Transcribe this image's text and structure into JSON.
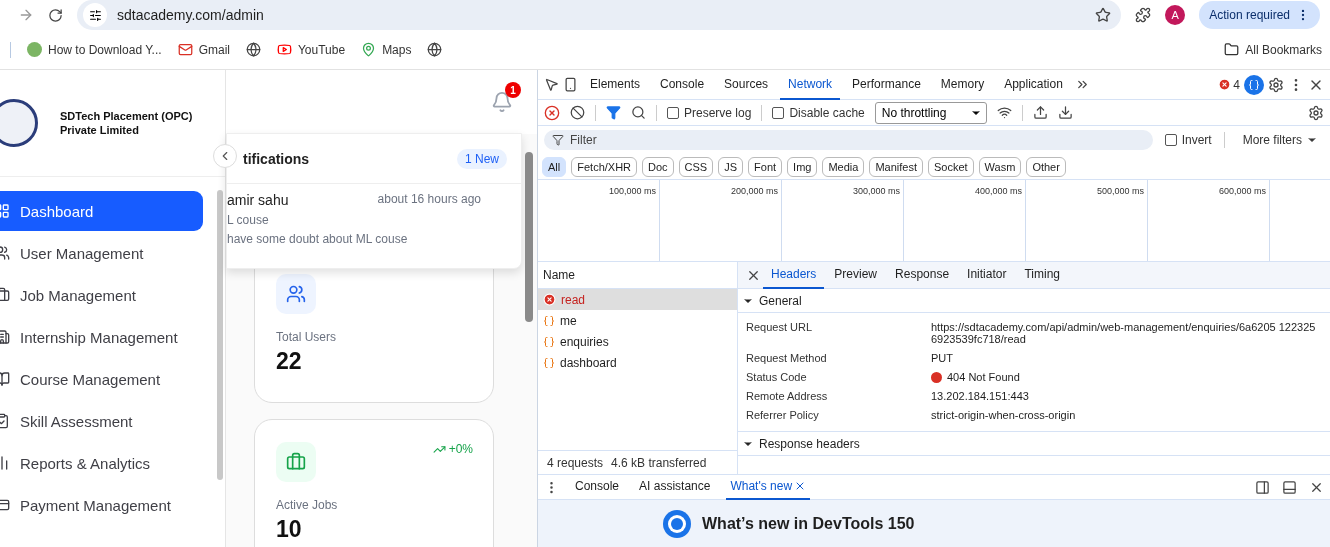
{
  "browser": {
    "address": "sdtacademy.com/admin",
    "profile_initial": "A",
    "action": "Action required",
    "bookmarks": [
      {
        "label": "How to Download Y...",
        "kind": "site"
      },
      {
        "label": "Gmail",
        "kind": "gmail"
      },
      {
        "kind": "globe"
      },
      {
        "label": "YouTube",
        "kind": "youtube"
      },
      {
        "label": "Maps",
        "kind": "maps"
      },
      {
        "kind": "globe"
      }
    ],
    "all_bookmarks": "All Bookmarks"
  },
  "page": {
    "company": "SDTech Placement (OPC) Private Limited",
    "notification_count": "1",
    "nav": [
      {
        "label": "Dashboard",
        "selected": true
      },
      {
        "label": "User Management",
        "selected": false
      },
      {
        "label": "Job Management",
        "selected": false
      },
      {
        "label": "Internship Management",
        "selected": false
      },
      {
        "label": "Course Management",
        "selected": false
      },
      {
        "label": "Skill Assessment",
        "selected": false
      },
      {
        "label": "Reports & Analytics",
        "selected": false
      },
      {
        "label": "Payment Management",
        "selected": false
      }
    ],
    "notifications": {
      "title": "tifications",
      "badge": "1 New",
      "items": [
        {
          "name": "amir sahu",
          "time": "about 16 hours ago",
          "subject": "L couse",
          "message": "have some doubt about ML couse"
        }
      ]
    },
    "stats": [
      {
        "kind": "users",
        "label": "Total Users",
        "value": "22"
      },
      {
        "kind": "jobs",
        "label": "Active Jobs",
        "value": "10",
        "change": "+0%"
      }
    ]
  },
  "devtools": {
    "panels": [
      {
        "label": "Elements",
        "selected": false
      },
      {
        "label": "Console",
        "selected": false
      },
      {
        "label": "Sources",
        "selected": false
      },
      {
        "label": "Network",
        "selected": true
      },
      {
        "label": "Performance",
        "selected": false
      },
      {
        "label": "Memory",
        "selected": false
      },
      {
        "label": "Application",
        "selected": false
      }
    ],
    "error_count": "4",
    "preserve_log": {
      "label": "Preserve log",
      "checked": false
    },
    "disable_cache": {
      "label": "Disable cache",
      "checked": false
    },
    "throttling": "No throttling",
    "filter_placeholder": "Filter",
    "invert": {
      "label": "Invert",
      "checked": false
    },
    "more_filters": "More filters",
    "type_filters": [
      {
        "label": "All",
        "selected": true
      },
      {
        "label": "Fetch/XHR",
        "selected": false
      },
      {
        "label": "Doc",
        "selected": false
      },
      {
        "label": "CSS",
        "selected": false
      },
      {
        "label": "JS",
        "selected": false
      },
      {
        "label": "Font",
        "selected": false
      },
      {
        "label": "Img",
        "selected": false
      },
      {
        "label": "Media",
        "selected": false
      },
      {
        "label": "Manifest",
        "selected": false
      },
      {
        "label": "Socket",
        "selected": false
      },
      {
        "label": "Wasm",
        "selected": false
      },
      {
        "label": "Other",
        "selected": false
      }
    ],
    "timeline_ticks": [
      "100,000 ms",
      "200,000 ms",
      "300,000 ms",
      "400,000 ms",
      "500,000 ms",
      "600,000 ms"
    ],
    "name_header": "Name",
    "requests": [
      {
        "name": "read",
        "failed": true,
        "selected": true
      },
      {
        "name": "me",
        "failed": false,
        "selected": false
      },
      {
        "name": "enquiries",
        "failed": false,
        "selected": false
      },
      {
        "name": "dashboard",
        "failed": false,
        "selected": false
      }
    ],
    "summary": [
      "4 requests",
      "4.6 kB transferred"
    ],
    "detail_tabs": [
      {
        "label": "Headers",
        "selected": true
      },
      {
        "label": "Preview",
        "selected": false
      },
      {
        "label": "Response",
        "selected": false
      },
      {
        "label": "Initiator",
        "selected": false
      },
      {
        "label": "Timing",
        "selected": false
      }
    ],
    "general_title": "General",
    "general": [
      {
        "label": "Request URL",
        "value": "https://sdtacademy.com/api/admin/web-management/enquiries/6a6205 1223256923539fc718/read"
      },
      {
        "label": "Request Method",
        "value": "PUT"
      },
      {
        "label": "Status Code",
        "value": "404 Not Found",
        "error": true
      },
      {
        "label": "Remote Address",
        "value": "13.202.184.151:443"
      },
      {
        "label": "Referrer Policy",
        "value": "strict-origin-when-cross-origin"
      }
    ],
    "response_headers_title": "Response headers",
    "drawer_tabs": [
      {
        "label": "Console",
        "selected": false,
        "closable": false
      },
      {
        "label": "AI assistance",
        "selected": false,
        "closable": false
      },
      {
        "label": "What's new",
        "selected": true,
        "closable": true
      }
    ],
    "whats_new_title": "What’s new in DevTools 150"
  }
}
